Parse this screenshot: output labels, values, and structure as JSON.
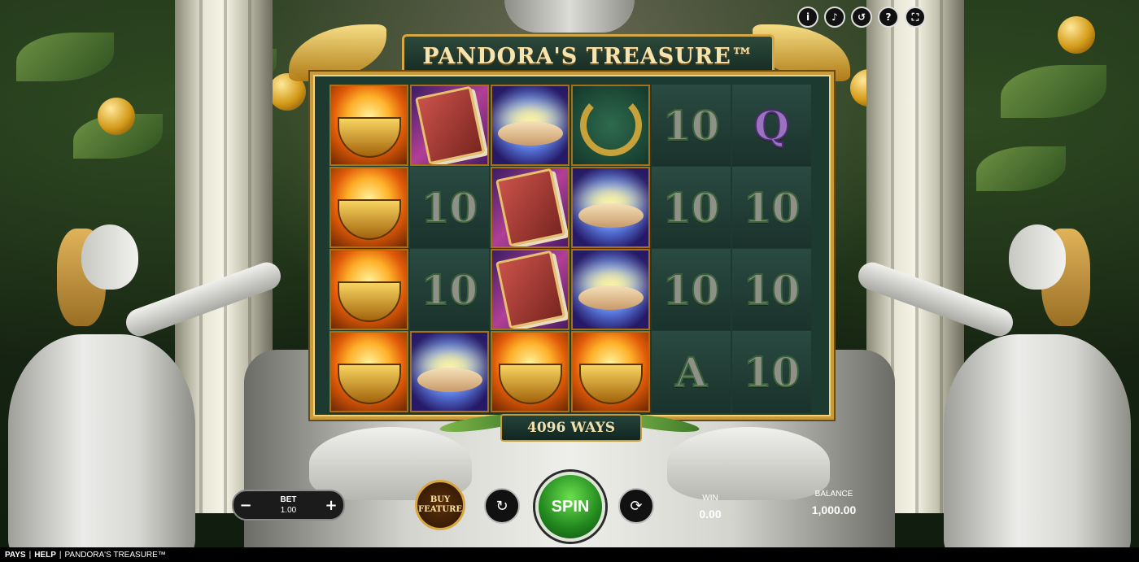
{
  "title": "PANDORA'S TREASURE™",
  "ways": "4096 WAYS",
  "top_icons": [
    "i",
    "♪",
    "↺",
    "?",
    "⛶"
  ],
  "reels": [
    [
      "flame",
      "flame",
      "flame",
      "flame"
    ],
    [
      "book",
      "10",
      "10",
      "hands"
    ],
    [
      "hands",
      "book",
      "book",
      "flame"
    ],
    [
      "wreath",
      "hands",
      "hands",
      "flame"
    ],
    [
      "10",
      "10",
      "10",
      "A"
    ],
    [
      "Q",
      "10",
      "10",
      "10"
    ]
  ],
  "controls": {
    "bet_label": "BET",
    "bet_value": "1.00",
    "minus": "−",
    "plus": "+",
    "buy_feature": "BUY FEATURE",
    "spin": "SPIN",
    "turbo_icon": "↻",
    "autoplay_icon": "⟳",
    "win_label": "WIN",
    "win_value": "0.00",
    "balance_label": "BALANCE",
    "balance_value": "1,000.00"
  },
  "footer": {
    "pays": "PAYS",
    "separator": "|",
    "help": "HELP",
    "game_name": "PANDORA'S TREASURE™"
  }
}
